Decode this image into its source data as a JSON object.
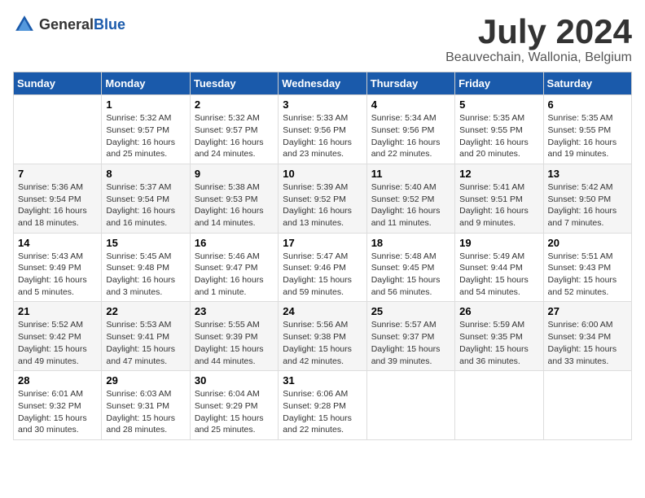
{
  "header": {
    "logo_general": "General",
    "logo_blue": "Blue",
    "month_title": "July 2024",
    "subtitle": "Beauvechain, Wallonia, Belgium"
  },
  "days_of_week": [
    "Sunday",
    "Monday",
    "Tuesday",
    "Wednesday",
    "Thursday",
    "Friday",
    "Saturday"
  ],
  "weeks": [
    [
      {
        "num": "",
        "info": ""
      },
      {
        "num": "1",
        "info": "Sunrise: 5:32 AM\nSunset: 9:57 PM\nDaylight: 16 hours\nand 25 minutes."
      },
      {
        "num": "2",
        "info": "Sunrise: 5:32 AM\nSunset: 9:57 PM\nDaylight: 16 hours\nand 24 minutes."
      },
      {
        "num": "3",
        "info": "Sunrise: 5:33 AM\nSunset: 9:56 PM\nDaylight: 16 hours\nand 23 minutes."
      },
      {
        "num": "4",
        "info": "Sunrise: 5:34 AM\nSunset: 9:56 PM\nDaylight: 16 hours\nand 22 minutes."
      },
      {
        "num": "5",
        "info": "Sunrise: 5:35 AM\nSunset: 9:55 PM\nDaylight: 16 hours\nand 20 minutes."
      },
      {
        "num": "6",
        "info": "Sunrise: 5:35 AM\nSunset: 9:55 PM\nDaylight: 16 hours\nand 19 minutes."
      }
    ],
    [
      {
        "num": "7",
        "info": "Sunrise: 5:36 AM\nSunset: 9:54 PM\nDaylight: 16 hours\nand 18 minutes."
      },
      {
        "num": "8",
        "info": "Sunrise: 5:37 AM\nSunset: 9:54 PM\nDaylight: 16 hours\nand 16 minutes."
      },
      {
        "num": "9",
        "info": "Sunrise: 5:38 AM\nSunset: 9:53 PM\nDaylight: 16 hours\nand 14 minutes."
      },
      {
        "num": "10",
        "info": "Sunrise: 5:39 AM\nSunset: 9:52 PM\nDaylight: 16 hours\nand 13 minutes."
      },
      {
        "num": "11",
        "info": "Sunrise: 5:40 AM\nSunset: 9:52 PM\nDaylight: 16 hours\nand 11 minutes."
      },
      {
        "num": "12",
        "info": "Sunrise: 5:41 AM\nSunset: 9:51 PM\nDaylight: 16 hours\nand 9 minutes."
      },
      {
        "num": "13",
        "info": "Sunrise: 5:42 AM\nSunset: 9:50 PM\nDaylight: 16 hours\nand 7 minutes."
      }
    ],
    [
      {
        "num": "14",
        "info": "Sunrise: 5:43 AM\nSunset: 9:49 PM\nDaylight: 16 hours\nand 5 minutes."
      },
      {
        "num": "15",
        "info": "Sunrise: 5:45 AM\nSunset: 9:48 PM\nDaylight: 16 hours\nand 3 minutes."
      },
      {
        "num": "16",
        "info": "Sunrise: 5:46 AM\nSunset: 9:47 PM\nDaylight: 16 hours\nand 1 minute."
      },
      {
        "num": "17",
        "info": "Sunrise: 5:47 AM\nSunset: 9:46 PM\nDaylight: 15 hours\nand 59 minutes."
      },
      {
        "num": "18",
        "info": "Sunrise: 5:48 AM\nSunset: 9:45 PM\nDaylight: 15 hours\nand 56 minutes."
      },
      {
        "num": "19",
        "info": "Sunrise: 5:49 AM\nSunset: 9:44 PM\nDaylight: 15 hours\nand 54 minutes."
      },
      {
        "num": "20",
        "info": "Sunrise: 5:51 AM\nSunset: 9:43 PM\nDaylight: 15 hours\nand 52 minutes."
      }
    ],
    [
      {
        "num": "21",
        "info": "Sunrise: 5:52 AM\nSunset: 9:42 PM\nDaylight: 15 hours\nand 49 minutes."
      },
      {
        "num": "22",
        "info": "Sunrise: 5:53 AM\nSunset: 9:41 PM\nDaylight: 15 hours\nand 47 minutes."
      },
      {
        "num": "23",
        "info": "Sunrise: 5:55 AM\nSunset: 9:39 PM\nDaylight: 15 hours\nand 44 minutes."
      },
      {
        "num": "24",
        "info": "Sunrise: 5:56 AM\nSunset: 9:38 PM\nDaylight: 15 hours\nand 42 minutes."
      },
      {
        "num": "25",
        "info": "Sunrise: 5:57 AM\nSunset: 9:37 PM\nDaylight: 15 hours\nand 39 minutes."
      },
      {
        "num": "26",
        "info": "Sunrise: 5:59 AM\nSunset: 9:35 PM\nDaylight: 15 hours\nand 36 minutes."
      },
      {
        "num": "27",
        "info": "Sunrise: 6:00 AM\nSunset: 9:34 PM\nDaylight: 15 hours\nand 33 minutes."
      }
    ],
    [
      {
        "num": "28",
        "info": "Sunrise: 6:01 AM\nSunset: 9:32 PM\nDaylight: 15 hours\nand 30 minutes."
      },
      {
        "num": "29",
        "info": "Sunrise: 6:03 AM\nSunset: 9:31 PM\nDaylight: 15 hours\nand 28 minutes."
      },
      {
        "num": "30",
        "info": "Sunrise: 6:04 AM\nSunset: 9:29 PM\nDaylight: 15 hours\nand 25 minutes."
      },
      {
        "num": "31",
        "info": "Sunrise: 6:06 AM\nSunset: 9:28 PM\nDaylight: 15 hours\nand 22 minutes."
      },
      {
        "num": "",
        "info": ""
      },
      {
        "num": "",
        "info": ""
      },
      {
        "num": "",
        "info": ""
      }
    ]
  ]
}
